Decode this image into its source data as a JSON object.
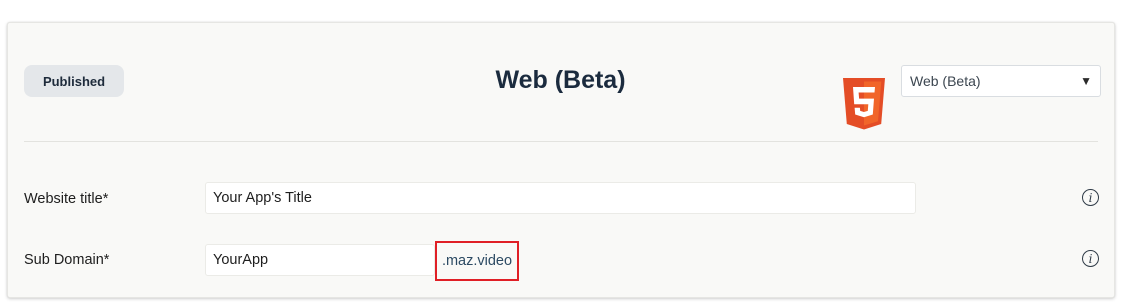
{
  "header": {
    "status_badge": "Published",
    "title": "Web (Beta)",
    "platform_logo_icon": "html5-logo-icon",
    "platform_select": {
      "value": "Web (Beta)",
      "arrow": "▼"
    }
  },
  "form": {
    "website_title": {
      "label": "Website title*",
      "value": "Your App's Title",
      "info_icon": "i"
    },
    "sub_domain": {
      "label": "Sub Domain*",
      "value": "YourApp",
      "suffix": ".maz.video",
      "info_icon": "i"
    }
  },
  "colors": {
    "panel_background": "#f9f9f7",
    "title_color": "#1b2b3e",
    "badge_background": "#e4e7ea",
    "html5_orange": "#e44d26",
    "html5_light_orange": "#f16529",
    "highlight_border": "#e01f26",
    "suffix_text": "#2c4a63"
  }
}
